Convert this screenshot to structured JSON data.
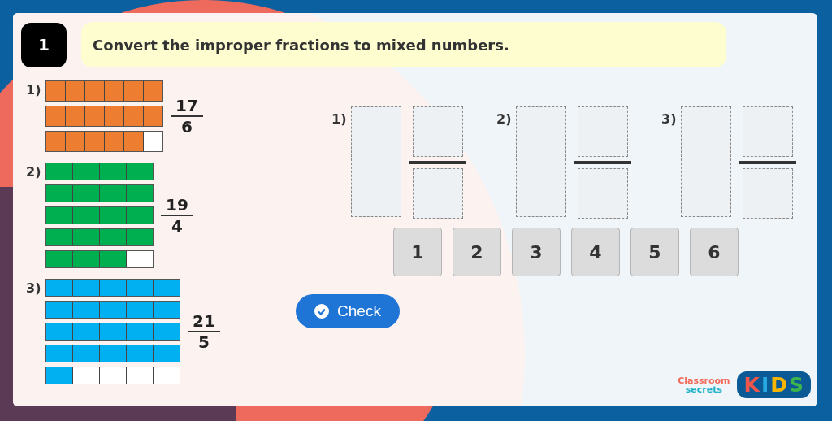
{
  "question": {
    "number": "1",
    "prompt": "Convert the improper fractions to mixed numbers."
  },
  "models": [
    {
      "label": "1)",
      "color": "#ed7d31",
      "numerator": "17",
      "denominator": "6",
      "rows": [
        {
          "cells": [
            {
              "filled": true
            },
            {
              "filled": true
            },
            {
              "filled": true
            },
            {
              "filled": true
            },
            {
              "filled": true
            },
            {
              "filled": true
            }
          ]
        },
        {
          "cells": [
            {
              "filled": true
            },
            {
              "filled": true
            },
            {
              "filled": true
            },
            {
              "filled": true
            },
            {
              "filled": true
            },
            {
              "filled": true
            }
          ]
        },
        {
          "cells": [
            {
              "filled": true
            },
            {
              "filled": true
            },
            {
              "filled": true
            },
            {
              "filled": true
            },
            {
              "filled": true
            },
            {
              "filled": false
            }
          ]
        }
      ]
    },
    {
      "label": "2)",
      "color": "#00b050",
      "numerator": "19",
      "denominator": "4",
      "rows": [
        {
          "cells": [
            {
              "filled": true
            },
            {
              "filled": true
            },
            {
              "filled": true
            },
            {
              "filled": true
            }
          ]
        },
        {
          "cells": [
            {
              "filled": true
            },
            {
              "filled": true
            },
            {
              "filled": true
            },
            {
              "filled": true
            }
          ]
        },
        {
          "cells": [
            {
              "filled": true
            },
            {
              "filled": true
            },
            {
              "filled": true
            },
            {
              "filled": true
            }
          ]
        },
        {
          "cells": [
            {
              "filled": true
            },
            {
              "filled": true
            },
            {
              "filled": true
            },
            {
              "filled": true
            }
          ]
        },
        {
          "cells": [
            {
              "filled": true
            },
            {
              "filled": true
            },
            {
              "filled": true
            },
            {
              "filled": false
            }
          ]
        }
      ]
    },
    {
      "label": "3)",
      "color": "#00b0f0",
      "numerator": "21",
      "denominator": "5",
      "rows": [
        {
          "cells": [
            {
              "filled": true
            },
            {
              "filled": true
            },
            {
              "filled": true
            },
            {
              "filled": true
            },
            {
              "filled": true
            }
          ]
        },
        {
          "cells": [
            {
              "filled": true
            },
            {
              "filled": true
            },
            {
              "filled": true
            },
            {
              "filled": true
            },
            {
              "filled": true
            }
          ]
        },
        {
          "cells": [
            {
              "filled": true
            },
            {
              "filled": true
            },
            {
              "filled": true
            },
            {
              "filled": true
            },
            {
              "filled": true
            }
          ]
        },
        {
          "cells": [
            {
              "filled": true
            },
            {
              "filled": true
            },
            {
              "filled": true
            },
            {
              "filled": true
            },
            {
              "filled": true
            }
          ]
        },
        {
          "cells": [
            {
              "filled": true
            },
            {
              "filled": false
            },
            {
              "filled": false
            },
            {
              "filled": false
            },
            {
              "filled": false
            }
          ]
        }
      ]
    }
  ],
  "answers": [
    {
      "label": "1)"
    },
    {
      "label": "2)"
    },
    {
      "label": "3)"
    }
  ],
  "tiles": [
    "1",
    "2",
    "3",
    "4",
    "5",
    "6"
  ],
  "check_button": "Check",
  "logo": {
    "line1": "Classroom",
    "line2": "secrets",
    "letters": [
      {
        "char": "K",
        "color": "#f0564a"
      },
      {
        "char": "I",
        "color": "#25a9e0"
      },
      {
        "char": "D",
        "color": "#f7b500"
      },
      {
        "char": "S",
        "color": "#3cb54a"
      }
    ]
  }
}
